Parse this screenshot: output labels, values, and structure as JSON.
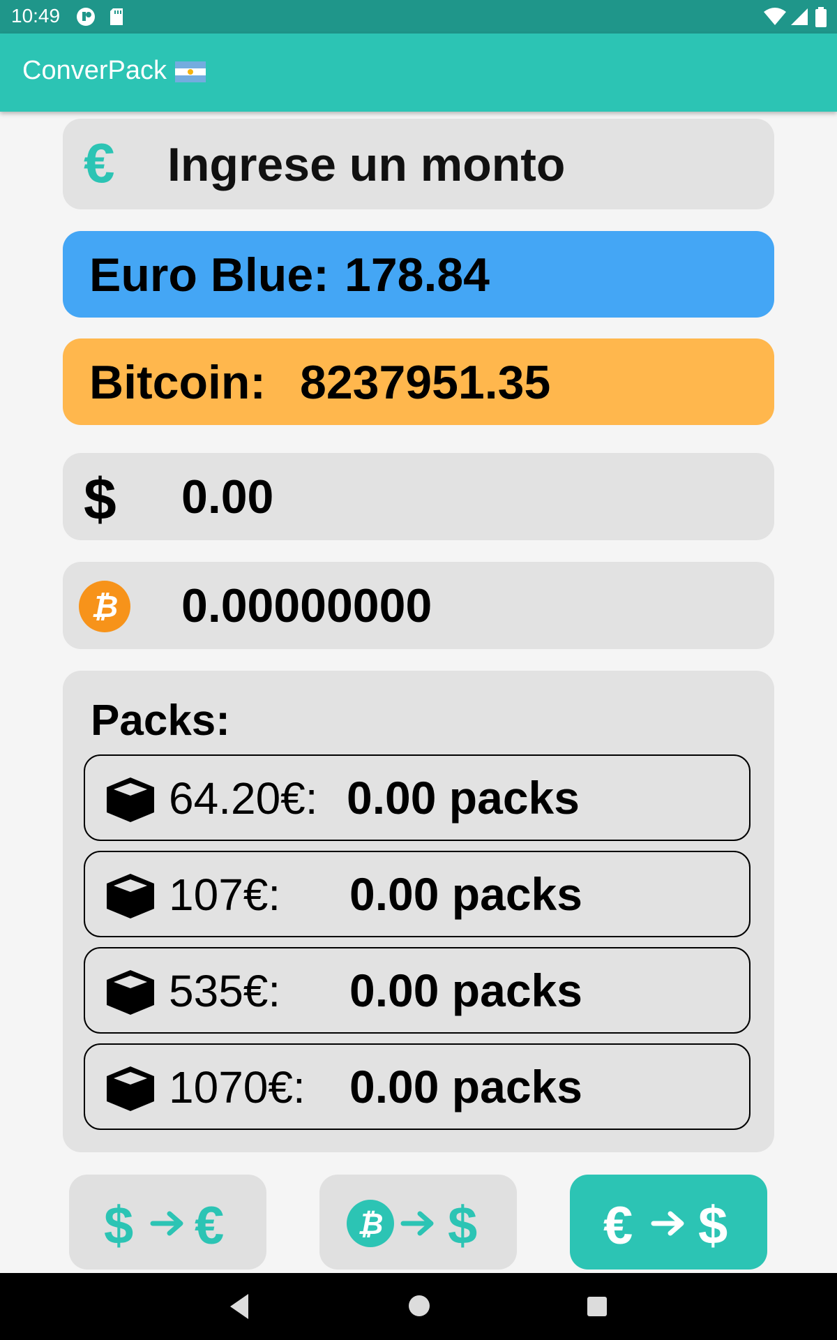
{
  "status_bar": {
    "time": "10:49"
  },
  "app_bar": {
    "title": "ConverPack"
  },
  "amount_input": {
    "currency_symbol": "€",
    "placeholder": "Ingrese un monto",
    "value": ""
  },
  "rates": {
    "euro_blue": {
      "label": "Euro Blue:",
      "value": "178.84",
      "color": "#44a6f5"
    },
    "bitcoin": {
      "label": "Bitcoin:",
      "value": "8237951.35",
      "color": "#ffb74d"
    }
  },
  "results": {
    "usd": {
      "symbol": "$",
      "value": "0.00"
    },
    "btc": {
      "symbol": "₿",
      "value": "0.00000000"
    }
  },
  "packs": {
    "title": "Packs:",
    "items": [
      {
        "price": "64.20€:",
        "count": "0.00 packs"
      },
      {
        "price": "107€:",
        "count": "0.00 packs"
      },
      {
        "price": "535€:",
        "count": "0.00 packs"
      },
      {
        "price": "1070€:",
        "count": "0.00 packs"
      }
    ]
  },
  "modes": [
    {
      "from": "$",
      "to": "€",
      "active": false
    },
    {
      "from": "₿",
      "to": "$",
      "active": false
    },
    {
      "from": "€",
      "to": "$",
      "active": true
    }
  ],
  "colors": {
    "accent": "#2cc4b4",
    "status_bar": "#1f968a",
    "bitcoin_orange": "#f7931a"
  }
}
